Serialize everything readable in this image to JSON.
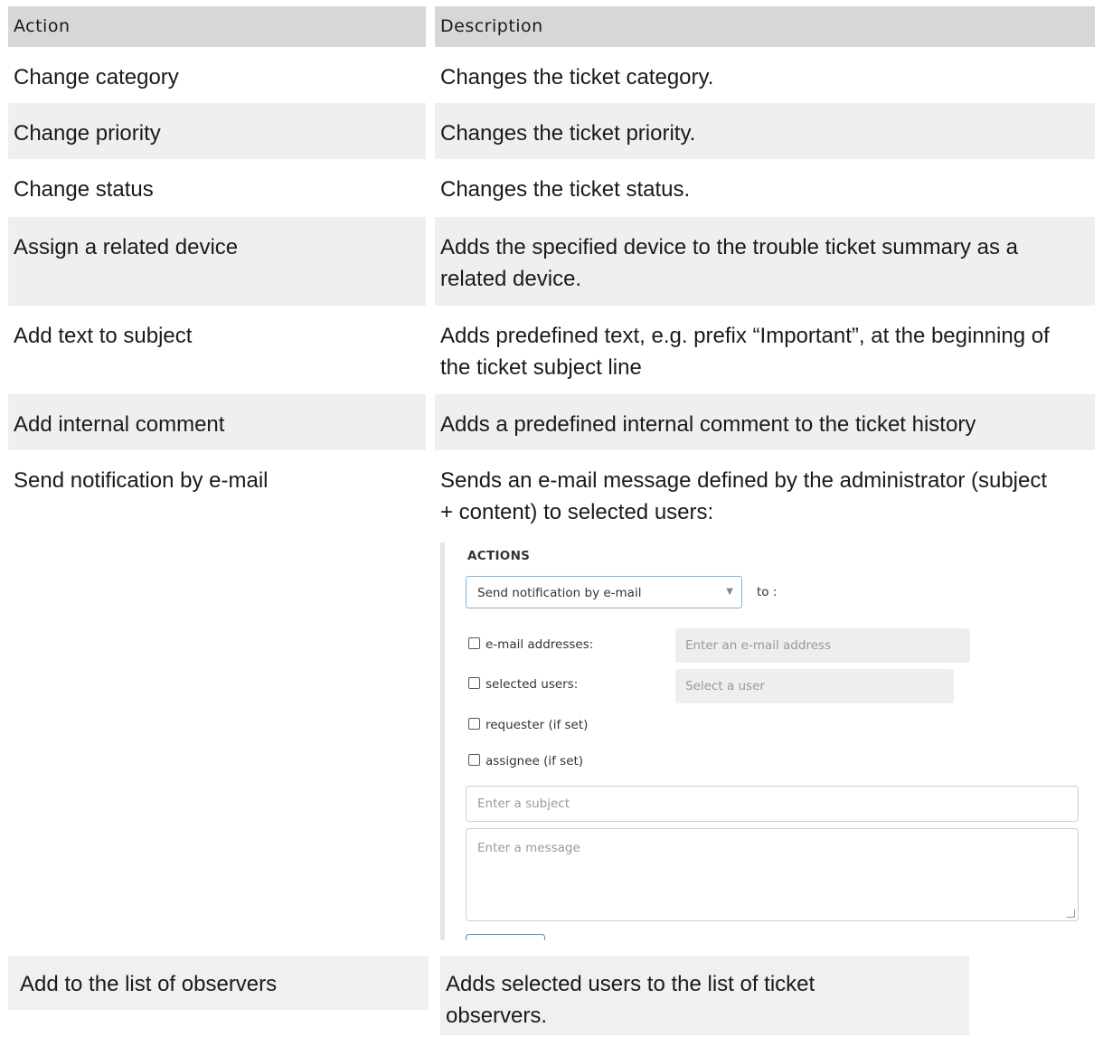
{
  "table": {
    "headers": [
      "Action",
      "Description"
    ],
    "rows": [
      {
        "action": "Change category",
        "description": "Changes the ticket category."
      },
      {
        "action": "Change priority",
        "description": "Changes the ticket priority."
      },
      {
        "action": "Change status",
        "description": "Changes the ticket status."
      },
      {
        "action": "Assign a related device",
        "description": "Adds the specified device to the trouble ticket summary as a related device."
      },
      {
        "action": "Add text to subject",
        "description": "Adds predefined text, e.g. prefix “Important”, at the beginning of the ticket subject line"
      },
      {
        "action": "Add internal comment",
        "description": "Adds a predefined internal comment to the ticket history"
      },
      {
        "action": "Send notification by e-mail",
        "description": "Sends an e-mail message defined by the administrator (subject + content) to selected users:"
      },
      {
        "action": "Add to the list of observers",
        "description": "Adds selected users to the list of ticket observers."
      }
    ]
  },
  "actions_panel": {
    "title": "ACTIONS",
    "selected_action": "Send notification by e-mail",
    "to_label": "to :",
    "checkboxes": [
      {
        "label": "e-mail addresses:",
        "checked": false
      },
      {
        "label": "selected users:",
        "checked": false
      },
      {
        "label": "requester (if set)",
        "checked": false
      },
      {
        "label": "assignee (if set)",
        "checked": false
      }
    ],
    "email_placeholder": "Enter an e-mail address",
    "user_placeholder": "Select a user",
    "subject_placeholder": "Enter a subject",
    "message_placeholder": "Enter a message",
    "accent_color": "#7eb7d6"
  }
}
